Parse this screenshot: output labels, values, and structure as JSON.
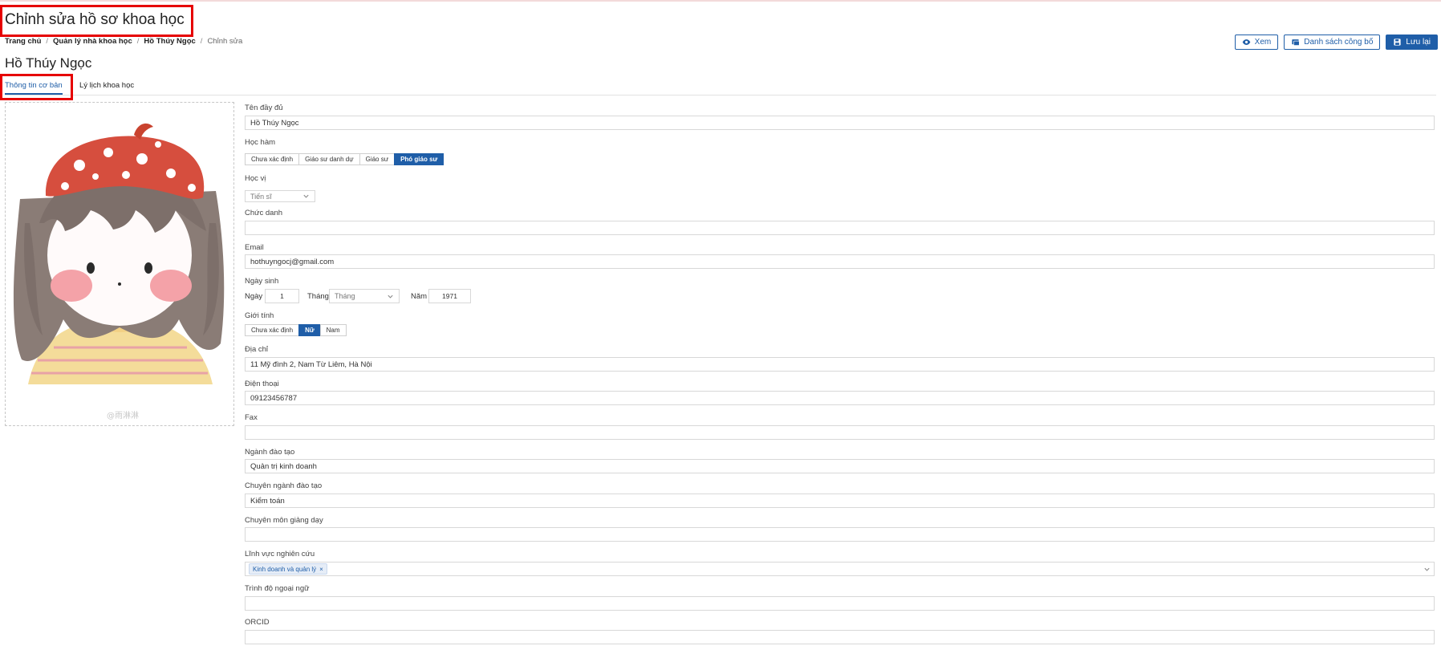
{
  "page": {
    "title": "Chỉnh sửa hồ sơ khoa học"
  },
  "breadcrumb": {
    "home": "Trang chủ",
    "manage": "Quản lý nhà khoa học",
    "person": "Hồ Thúy Ngọc",
    "current": "Chỉnh sửa",
    "separator": "/"
  },
  "toolbar": {
    "view_label": "Xem",
    "publications_label": "Danh sách công bố",
    "save_label": "Lưu lại"
  },
  "person": {
    "name": "Hồ Thúy Ngọc"
  },
  "tabs": [
    {
      "label": "Thông tin cơ bản",
      "active": true
    },
    {
      "label": "Lý lịch khoa học",
      "active": false
    }
  ],
  "avatar": {
    "watermark": "@雨淋淋"
  },
  "form": {
    "fullname": {
      "label": "Tên đầy đủ",
      "value": "Hồ Thúy Ngọc"
    },
    "academic_rank": {
      "label": "Học hàm",
      "options": [
        "Chưa xác định",
        "Giáo sư danh dự",
        "Giáo sư",
        "Phó giáo sư"
      ],
      "selected": "Phó giáo sư"
    },
    "degree": {
      "label": "Học vị",
      "value": "Tiến sĩ"
    },
    "position": {
      "label": "Chức danh",
      "value": ""
    },
    "email": {
      "label": "Email",
      "value": "hothuyngocj@gmail.com"
    },
    "birthday": {
      "label": "Ngày sinh",
      "day_label": "Ngày",
      "day": "1",
      "month_label": "Tháng",
      "month_placeholder": "Tháng",
      "year_label": "Năm",
      "year": "1971"
    },
    "gender": {
      "label": "Giới tính",
      "options": [
        "Chưa xác định",
        "Nữ",
        "Nam"
      ],
      "selected": "Nữ"
    },
    "address": {
      "label": "Địa chỉ",
      "value": "11  Mỹ đình 2, Nam Từ Liêm, Hà Nội"
    },
    "phone": {
      "label": "Điện thoại",
      "value": "09123456787"
    },
    "fax": {
      "label": "Fax",
      "value": ""
    },
    "major": {
      "label": "Ngành đào tạo",
      "value": "Quản trị kinh doanh"
    },
    "specialization": {
      "label": "Chuyên ngành đào tạo",
      "value": "Kiểm toán"
    },
    "teaching": {
      "label": "Chuyên môn giảng dạy",
      "value": ""
    },
    "research_fields": {
      "label": "Lĩnh vực nghiên cứu",
      "tags": [
        "Kinh doanh và quản lý"
      ]
    },
    "language": {
      "label": "Trình độ ngoại ngữ",
      "value": ""
    },
    "orcid": {
      "label": "ORCID",
      "value": ""
    }
  },
  "colors": {
    "primary": "#1f5ea8",
    "highlight": "#e60000"
  }
}
